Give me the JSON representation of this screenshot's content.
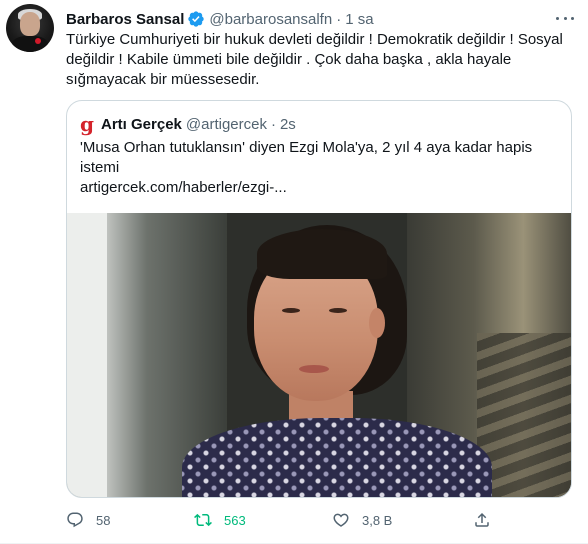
{
  "tweet": {
    "author_name": "Barbaros Sansal",
    "handle": "@barbarosansalfn",
    "separator": "·",
    "time": "1 sa",
    "text": "Türkiye Cumhuriyeti bir hukuk devleti değildir ! Demokratik değildir ! Sosyal değildir ! Kabile ümmeti bile değildir . Çok daha başka , akla hayale sığmayacak bir müessesedir."
  },
  "quote": {
    "logo_letter": "g",
    "author_name": "Artı Gerçek",
    "handle": "@artigercek",
    "separator": "·",
    "time": "2s",
    "text": "'Musa Orhan tutuklansın' diyen Ezgi Mola'ya, 2 yıl 4 aya kadar hapis istemi",
    "link": "artigercek.com/haberler/ezgi-..."
  },
  "actions": {
    "replies": "58",
    "retweets": "563",
    "likes": "3,8 B"
  },
  "colors": {
    "verified": "#1d9bf0",
    "retweet": "#00ba7c",
    "secondary_text": "#536471",
    "logo": "#d4232b"
  },
  "icons": [
    "verified-badge-icon",
    "more-icon",
    "reply-icon",
    "retweet-icon",
    "like-icon",
    "share-icon"
  ]
}
